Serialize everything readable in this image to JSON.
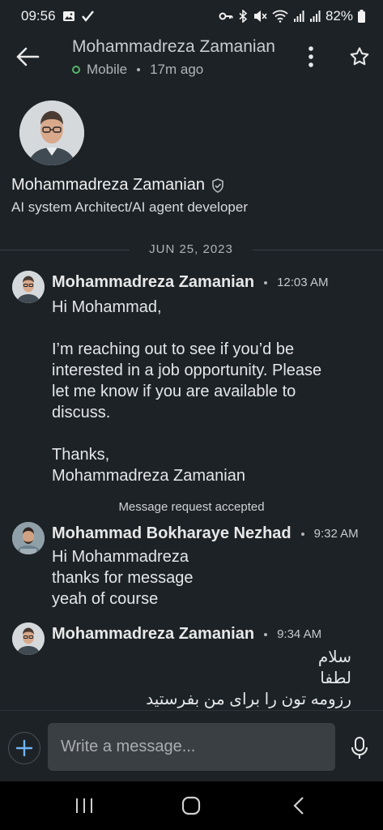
{
  "status_bar": {
    "time": "09:56",
    "battery_text": "82%",
    "icons": [
      "image-icon",
      "check-icon",
      "key-icon",
      "bluetooth-icon",
      "mute-icon",
      "wifi-icon",
      "signal-icon",
      "signal-icon",
      "battery-icon"
    ]
  },
  "header": {
    "title": "Mohammadreza Zamanian",
    "presence": "Mobile",
    "last_seen": "17m ago"
  },
  "profile": {
    "name": "Mohammadreza Zamanian",
    "headline": "AI system Architect/AI agent developer"
  },
  "date_divider": "JUN 25, 2023",
  "messages": [
    {
      "sender": "Mohammadreza Zamanian",
      "time": "12:03 AM",
      "lines": [
        "Hi Mohammad,",
        "",
        "I’m reaching out to see if you’d be",
        "interested in a job opportunity. Please",
        "let me know if you are available to",
        "discuss.",
        "",
        "Thanks,",
        "Mohammadreza Zamanian"
      ]
    },
    {
      "sender": "Mohammad Bokharaye Nezhad",
      "time": "9:32 AM",
      "lines": [
        "Hi Mohammadreza",
        "thanks for message",
        "yeah of course"
      ]
    },
    {
      "sender": "Mohammadreza Zamanian",
      "time": "9:34 AM",
      "lines": [
        "سلام",
        "لطفا",
        "رزومه تون را برای من بفرستید"
      ]
    }
  ],
  "system_note": "Message request accepted",
  "composer": {
    "placeholder": "Write a message..."
  },
  "colors": {
    "background": "#1d2226",
    "online": "#57b46a",
    "input_bg": "#3a3f44",
    "add_accent": "#70b5f9"
  }
}
